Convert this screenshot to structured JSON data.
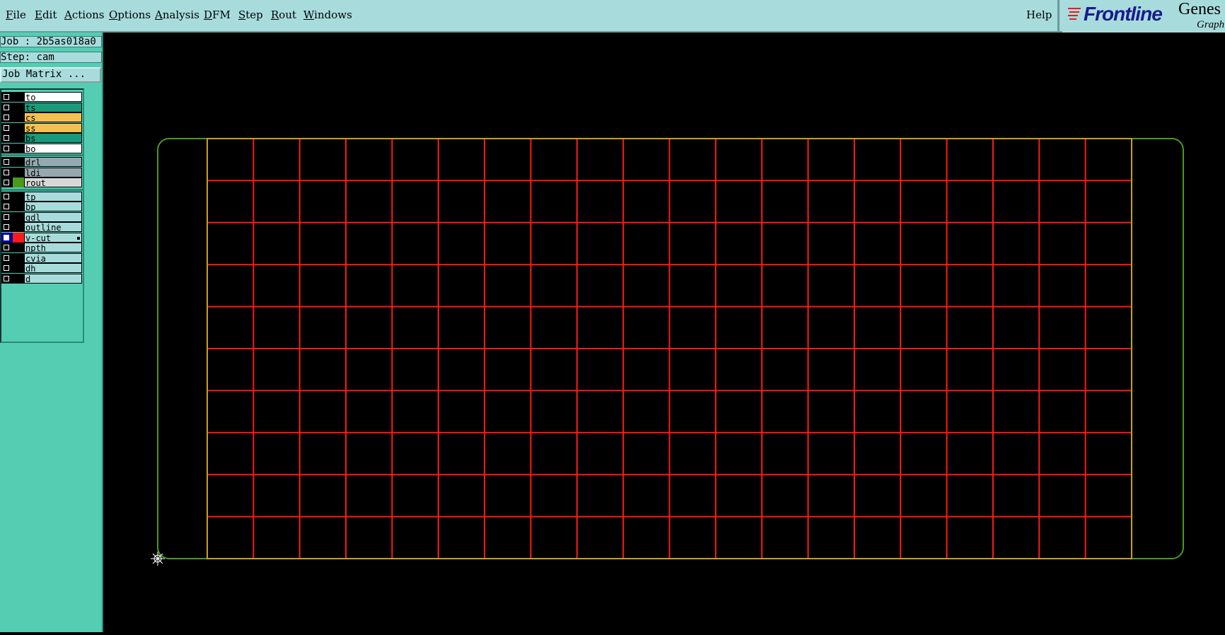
{
  "menu": {
    "file": "File",
    "edit": "Edit",
    "actions": "Actions",
    "options": "Options",
    "analysis": "Analysis",
    "dfm": "DFM",
    "step": "Step",
    "rout": "Rout",
    "windows": "Windows",
    "help": "Help"
  },
  "branding": {
    "logo": "Frontline",
    "product": "Genes",
    "subtitle": "Graph"
  },
  "panel": {
    "job_line": "Job : 2b5as018a0",
    "step_line": "Step: cam",
    "job_matrix_label": "Job Matrix ..."
  },
  "layers": [
    {
      "name": "to",
      "bg": "#ffffff",
      "color": "#000000"
    },
    {
      "name": "ts",
      "bg": "#1a9a7a",
      "color": "#000000"
    },
    {
      "name": "cs",
      "bg": "#f5c052",
      "color": "#000000"
    },
    {
      "name": "ss",
      "bg": "#f5c052",
      "color": "#000000"
    },
    {
      "name": "bs",
      "bg": "#1a9a7a",
      "color": "#000000"
    },
    {
      "name": "bo",
      "bg": "#ffffff",
      "color": "#000000"
    },
    {
      "name": "drl",
      "bg": "#96a8b0",
      "color": "#000000"
    },
    {
      "name": "ldi",
      "bg": "#96a8b0",
      "color": "#000000"
    },
    {
      "name": "rout",
      "bg": "#d8d8d8",
      "color": "#4a9a1a"
    },
    {
      "name": "tp",
      "bg": "#a8dcdc",
      "color": "#000000"
    },
    {
      "name": "bp",
      "bg": "#a8dcdc",
      "color": "#000000"
    },
    {
      "name": "gdl",
      "bg": "#a8dcdc",
      "color": "#000000"
    },
    {
      "name": "outline",
      "bg": "#a8dcdc",
      "color": "#000000"
    },
    {
      "name": "v-cut",
      "bg": "#a8dcdc",
      "color": "#ff1a1a",
      "active": true
    },
    {
      "name": "npth",
      "bg": "#a8dcdc",
      "color": "#000000"
    },
    {
      "name": "cvia",
      "bg": "#a8dcdc",
      "color": "#000000"
    },
    {
      "name": "dh",
      "bg": "#a8dcdc",
      "color": "#000000"
    },
    {
      "name": "d",
      "bg": "#a8dcdc",
      "color": "#000000"
    }
  ],
  "drawing": {
    "panel_outline_color": "#4a9a1a",
    "board_outline_color": "#c8a020",
    "vcut_color": "#ff1a1a",
    "vcut_columns": 20,
    "vcut_rows": 10
  }
}
